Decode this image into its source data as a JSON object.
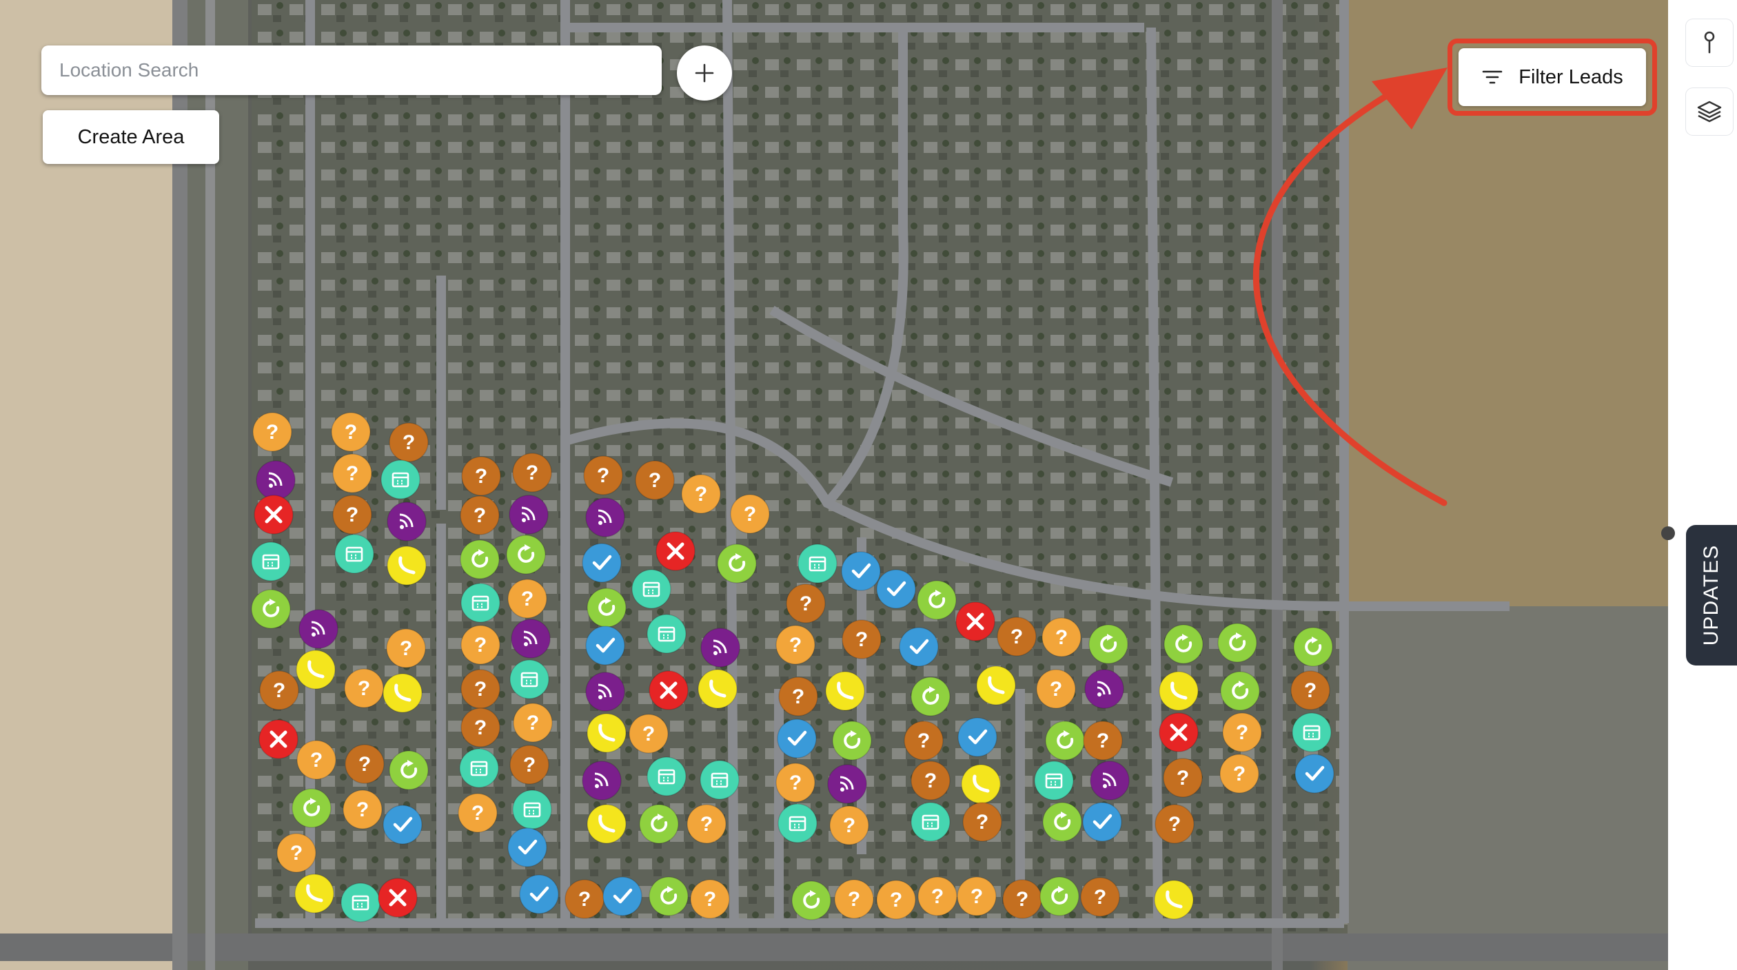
{
  "search": {
    "placeholder": "Location Search"
  },
  "buttons": {
    "create_area": "Create Area",
    "filter_leads": "Filter Leads"
  },
  "sidebar": {
    "updates_label": "UPDATES"
  },
  "icons": {
    "add": "plus-icon",
    "filter": "filter-lines-icon",
    "pin": "map-pin-icon",
    "layers": "layers-icon"
  },
  "colors": {
    "annotation": "#e0412c",
    "unknown": "#f2a53a",
    "unknown_dark": "#c46f20",
    "not_home": "#7b1f8c",
    "no": "#e62525",
    "appointment": "#45d6b0",
    "callback": "#8fd13f",
    "phone": "#f4e51d",
    "done": "#3a9ad9"
  },
  "lead_markers": [
    {
      "s": "unknown",
      "c": [
        395,
        627
      ]
    },
    {
      "s": "unknown",
      "c": [
        509,
        627
      ]
    },
    {
      "s": "unknown_dark",
      "c": [
        593,
        642
      ]
    },
    {
      "s": "not_home",
      "c": [
        400,
        697
      ]
    },
    {
      "s": "unknown",
      "c": [
        511,
        687
      ]
    },
    {
      "s": "appointment",
      "c": [
        581,
        696
      ]
    },
    {
      "s": "no",
      "c": [
        397,
        747
      ]
    },
    {
      "s": "unknown_dark",
      "c": [
        511,
        747
      ]
    },
    {
      "s": "not_home",
      "c": [
        590,
        757
      ]
    },
    {
      "s": "appointment",
      "c": [
        393,
        815
      ]
    },
    {
      "s": "appointment",
      "c": [
        514,
        804
      ]
    },
    {
      "s": "phone",
      "c": [
        590,
        821
      ]
    },
    {
      "s": "callback",
      "c": [
        393,
        884
      ]
    },
    {
      "s": "not_home",
      "c": [
        462,
        913
      ]
    },
    {
      "s": "unknown",
      "c": [
        589,
        941
      ]
    },
    {
      "s": "phone",
      "c": [
        458,
        972
      ]
    },
    {
      "s": "unknown_dark",
      "c": [
        405,
        1002
      ]
    },
    {
      "s": "unknown",
      "c": [
        528,
        999
      ]
    },
    {
      "s": "phone",
      "c": [
        584,
        1006
      ]
    },
    {
      "s": "no",
      "c": [
        404,
        1073
      ]
    },
    {
      "s": "unknown",
      "c": [
        459,
        1103
      ]
    },
    {
      "s": "unknown_dark",
      "c": [
        529,
        1109
      ]
    },
    {
      "s": "callback",
      "c": [
        593,
        1118
      ]
    },
    {
      "s": "callback",
      "c": [
        452,
        1173
      ]
    },
    {
      "s": "unknown",
      "c": [
        526,
        1175
      ]
    },
    {
      "s": "done",
      "c": [
        584,
        1197
      ]
    },
    {
      "s": "unknown",
      "c": [
        430,
        1238
      ]
    },
    {
      "s": "phone",
      "c": [
        456,
        1297
      ]
    },
    {
      "s": "appointment",
      "c": [
        523,
        1310
      ]
    },
    {
      "s": "no",
      "c": [
        577,
        1303
      ]
    },
    {
      "s": "unknown_dark",
      "c": [
        698,
        691
      ]
    },
    {
      "s": "unknown_dark",
      "c": [
        772,
        686
      ]
    },
    {
      "s": "unknown_dark",
      "c": [
        696,
        748
      ]
    },
    {
      "s": "not_home",
      "c": [
        767,
        747
      ]
    },
    {
      "s": "callback",
      "c": [
        696,
        812
      ]
    },
    {
      "s": "callback",
      "c": [
        763,
        805
      ]
    },
    {
      "s": "appointment",
      "c": [
        697,
        875
      ]
    },
    {
      "s": "unknown",
      "c": [
        765,
        869
      ]
    },
    {
      "s": "unknown",
      "c": [
        697,
        936
      ]
    },
    {
      "s": "not_home",
      "c": [
        770,
        927
      ]
    },
    {
      "s": "unknown_dark",
      "c": [
        697,
        1000
      ]
    },
    {
      "s": "appointment",
      "c": [
        768,
        986
      ]
    },
    {
      "s": "unknown_dark",
      "c": [
        697,
        1056
      ]
    },
    {
      "s": "unknown",
      "c": [
        773,
        1049
      ]
    },
    {
      "s": "appointment",
      "c": [
        695,
        1115
      ]
    },
    {
      "s": "unknown_dark",
      "c": [
        768,
        1110
      ]
    },
    {
      "s": "unknown",
      "c": [
        693,
        1180
      ]
    },
    {
      "s": "appointment",
      "c": [
        772,
        1175
      ]
    },
    {
      "s": "done",
      "c": [
        765,
        1230
      ]
    },
    {
      "s": "done",
      "c": [
        782,
        1298
      ]
    },
    {
      "s": "unknown_dark",
      "c": [
        848,
        1305
      ]
    },
    {
      "s": "done",
      "c": [
        903,
        1301
      ]
    },
    {
      "s": "callback",
      "c": [
        970,
        1301
      ]
    },
    {
      "s": "unknown",
      "c": [
        1030,
        1305
      ]
    },
    {
      "s": "unknown_dark",
      "c": [
        875,
        690
      ]
    },
    {
      "s": "unknown_dark",
      "c": [
        950,
        697
      ]
    },
    {
      "s": "unknown",
      "c": [
        1017,
        717
      ]
    },
    {
      "s": "unknown",
      "c": [
        1088,
        746
      ]
    },
    {
      "s": "not_home",
      "c": [
        878,
        751
      ]
    },
    {
      "s": "no",
      "c": [
        980,
        800
      ]
    },
    {
      "s": "callback",
      "c": [
        1069,
        818
      ]
    },
    {
      "s": "done",
      "c": [
        873,
        817
      ]
    },
    {
      "s": "appointment",
      "c": [
        945,
        855
      ]
    },
    {
      "s": "callback",
      "c": [
        880,
        882
      ]
    },
    {
      "s": "appointment",
      "c": [
        967,
        920
      ]
    },
    {
      "s": "done",
      "c": [
        878,
        937
      ]
    },
    {
      "s": "not_home",
      "c": [
        1045,
        940
      ]
    },
    {
      "s": "not_home",
      "c": [
        878,
        1004
      ]
    },
    {
      "s": "no",
      "c": [
        970,
        1002
      ]
    },
    {
      "s": "phone",
      "c": [
        1041,
        1000
      ]
    },
    {
      "s": "phone",
      "c": [
        880,
        1064
      ]
    },
    {
      "s": "unknown",
      "c": [
        941,
        1065
      ]
    },
    {
      "s": "not_home",
      "c": [
        873,
        1133
      ]
    },
    {
      "s": "appointment",
      "c": [
        967,
        1127
      ]
    },
    {
      "s": "appointment",
      "c": [
        1044,
        1132
      ]
    },
    {
      "s": "phone",
      "c": [
        880,
        1196
      ]
    },
    {
      "s": "callback",
      "c": [
        956,
        1196
      ]
    },
    {
      "s": "unknown",
      "c": [
        1025,
        1196
      ]
    },
    {
      "s": "appointment",
      "c": [
        1186,
        818
      ]
    },
    {
      "s": "done",
      "c": [
        1249,
        829
      ]
    },
    {
      "s": "done",
      "c": [
        1300,
        855
      ]
    },
    {
      "s": "callback",
      "c": [
        1359,
        871
      ]
    },
    {
      "s": "unknown_dark",
      "c": [
        1169,
        876
      ]
    },
    {
      "s": "unknown",
      "c": [
        1154,
        936
      ]
    },
    {
      "s": "unknown_dark",
      "c": [
        1250,
        928
      ]
    },
    {
      "s": "done",
      "c": [
        1333,
        939
      ]
    },
    {
      "s": "no",
      "c": [
        1415,
        902
      ]
    },
    {
      "s": "unknown_dark",
      "c": [
        1475,
        924
      ]
    },
    {
      "s": "unknown",
      "c": [
        1540,
        925
      ]
    },
    {
      "s": "callback",
      "c": [
        1608,
        935
      ]
    },
    {
      "s": "unknown_dark",
      "c": [
        1158,
        1011
      ]
    },
    {
      "s": "phone",
      "c": [
        1226,
        1003
      ]
    },
    {
      "s": "callback",
      "c": [
        1350,
        1011
      ]
    },
    {
      "s": "phone",
      "c": [
        1445,
        995
      ]
    },
    {
      "s": "unknown",
      "c": [
        1532,
        1000
      ]
    },
    {
      "s": "not_home",
      "c": [
        1602,
        1000
      ]
    },
    {
      "s": "done",
      "c": [
        1156,
        1072
      ]
    },
    {
      "s": "callback",
      "c": [
        1236,
        1075
      ]
    },
    {
      "s": "unknown_dark",
      "c": [
        1340,
        1075
      ]
    },
    {
      "s": "done",
      "c": [
        1418,
        1070
      ]
    },
    {
      "s": "callback",
      "c": [
        1545,
        1075
      ]
    },
    {
      "s": "unknown_dark",
      "c": [
        1600,
        1075
      ]
    },
    {
      "s": "unknown",
      "c": [
        1154,
        1136
      ]
    },
    {
      "s": "not_home",
      "c": [
        1229,
        1138
      ]
    },
    {
      "s": "unknown_dark",
      "c": [
        1350,
        1133
      ]
    },
    {
      "s": "phone",
      "c": [
        1423,
        1138
      ]
    },
    {
      "s": "appointment",
      "c": [
        1529,
        1133
      ]
    },
    {
      "s": "not_home",
      "c": [
        1610,
        1133
      ]
    },
    {
      "s": "appointment",
      "c": [
        1157,
        1195
      ]
    },
    {
      "s": "unknown",
      "c": [
        1232,
        1198
      ]
    },
    {
      "s": "appointment",
      "c": [
        1350,
        1193
      ]
    },
    {
      "s": "unknown_dark",
      "c": [
        1425,
        1193
      ]
    },
    {
      "s": "callback",
      "c": [
        1541,
        1193
      ]
    },
    {
      "s": "done",
      "c": [
        1599,
        1193
      ]
    },
    {
      "s": "callback",
      "c": [
        1177,
        1307
      ]
    },
    {
      "s": "unknown",
      "c": [
        1239,
        1305
      ]
    },
    {
      "s": "unknown",
      "c": [
        1300,
        1306
      ]
    },
    {
      "s": "unknown",
      "c": [
        1360,
        1301
      ]
    },
    {
      "s": "unknown",
      "c": [
        1417,
        1301
      ]
    },
    {
      "s": "unknown_dark",
      "c": [
        1483,
        1305
      ]
    },
    {
      "s": "callback",
      "c": [
        1537,
        1301
      ]
    },
    {
      "s": "unknown_dark",
      "c": [
        1596,
        1302
      ]
    },
    {
      "s": "phone",
      "c": [
        1703,
        1306
      ]
    },
    {
      "s": "callback",
      "c": [
        1717,
        935
      ]
    },
    {
      "s": "callback",
      "c": [
        1795,
        933
      ]
    },
    {
      "s": "callback",
      "c": [
        1905,
        939
      ]
    },
    {
      "s": "phone",
      "c": [
        1710,
        1003
      ]
    },
    {
      "s": "callback",
      "c": [
        1799,
        1003
      ]
    },
    {
      "s": "unknown_dark",
      "c": [
        1901,
        1002
      ]
    },
    {
      "s": "no",
      "c": [
        1710,
        1063
      ]
    },
    {
      "s": "unknown",
      "c": [
        1802,
        1063
      ]
    },
    {
      "s": "appointment",
      "c": [
        1903,
        1063
      ]
    },
    {
      "s": "unknown_dark",
      "c": [
        1716,
        1129
      ]
    },
    {
      "s": "unknown",
      "c": [
        1798,
        1123
      ]
    },
    {
      "s": "done",
      "c": [
        1907,
        1123
      ]
    },
    {
      "s": "unknown_dark",
      "c": [
        1704,
        1196
      ]
    }
  ]
}
